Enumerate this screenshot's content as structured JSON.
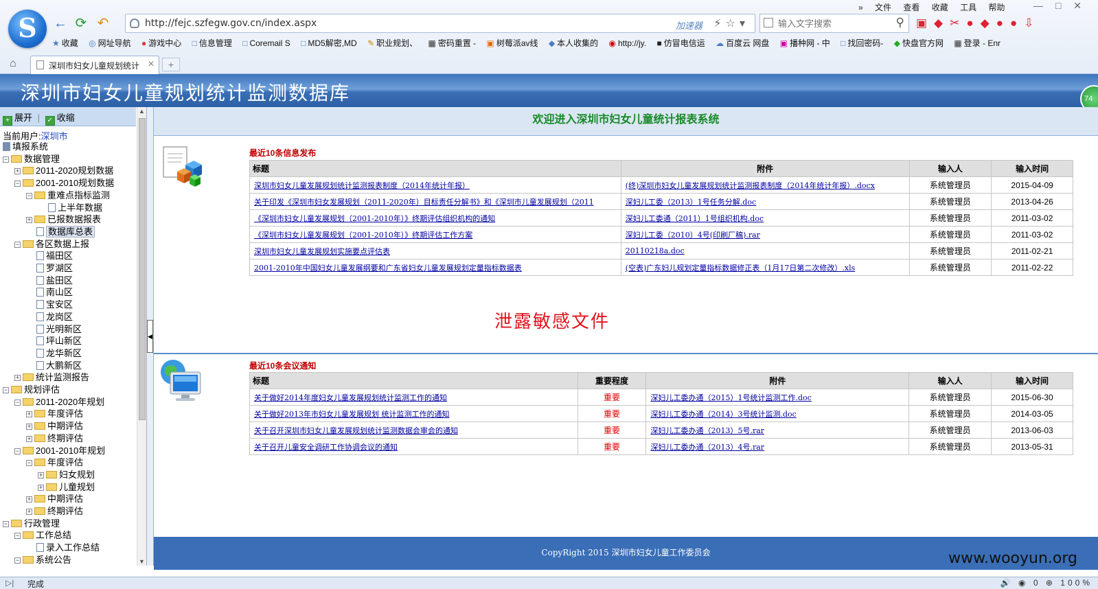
{
  "browser": {
    "menu": [
      "文件",
      "查看",
      "收藏",
      "工具",
      "帮助"
    ],
    "url": "http://fejc.szfegw.gov.cn/index.aspx",
    "accelerator": "加速器",
    "search_placeholder": "输入文字搜索",
    "bookmarks": [
      "收藏",
      "网址导航",
      "游戏中心",
      "信息管理",
      "Coremail S",
      "MD5解密,MD",
      "职业规划、",
      "密码重置 -",
      "树莓派av线",
      "本人收集的",
      "http://jy.",
      "仿冒电信运",
      "百度云 网盘",
      "播种网 - 中",
      "找回密码-",
      "快盘官方网",
      "登录 - Enr"
    ],
    "tab_title": "深圳市妇女儿童规划统计",
    "status_left": "完成",
    "status_right": "100%",
    "status_count": "0"
  },
  "page": {
    "banner_title": "深圳市妇女儿童规划统计监测数据库",
    "badge": "74",
    "sidebar": {
      "expand": "展开",
      "collapse": "收缩",
      "current_user_label": "当前用户:",
      "current_user": "深圳市",
      "tree": [
        "填报系统",
        "数据管理",
        "2011-2020规划数据",
        "2001-2010规划数据",
        "重难点指标监测",
        "上半年数据",
        "已报数据报表",
        "数据库总表",
        "各区数据上报",
        "福田区",
        "罗湖区",
        "盐田区",
        "南山区",
        "宝安区",
        "龙岗区",
        "光明新区",
        "坪山新区",
        "龙华新区",
        "大鹏新区",
        "统计监测报告",
        "规划评估",
        "2011-2020年规划",
        "年度评估",
        "中期评估",
        "终期评估",
        "2001-2010年规划",
        "年度评估",
        "妇女规划",
        "儿童规划",
        "中期评估",
        "终期评估",
        "行政管理",
        "工作总结",
        "录入工作总结",
        "系统公告"
      ]
    },
    "welcome": "欢迎进入深圳市妇女儿童统计报表系统",
    "info": {
      "title": "最近10条信息发布",
      "headers": [
        "标题",
        "附件",
        "输入人",
        "输入时间"
      ],
      "rows": [
        [
          "深圳市妇女儿童发展规划统计监测报表制度（2014年统计年报）",
          "(终)深圳市妇女儿童发展规划统计监测报表制度（2014年统计年报）.docx",
          "系统管理员",
          "2015-04-09"
        ],
        [
          "关于印发《深圳市妇女发展规划（2011-2020年）目标责任分解书》和《深圳市儿童发展规划（2011",
          "深妇儿工委（2013）1号任务分解.doc",
          "系统管理员",
          "2013-04-26"
        ],
        [
          "《深圳市妇女儿童发展规划（2001-2010年）》终期评估组织机构的通知",
          "深妇儿工委通（2011）1号组织机构.doc",
          "系统管理员",
          "2011-03-02"
        ],
        [
          "《深圳市妇女儿童发展规划（2001-2010年）》终期评估工作方案",
          "深妇儿工委（2010）4号(印刷厂稿).rar",
          "系统管理员",
          "2011-03-02"
        ],
        [
          "深圳市妇女儿童发展规划实施要点评估表",
          "20110218a.doc",
          "系统管理员",
          "2011-02-21"
        ],
        [
          "2001-2010年中国妇女儿童发展纲要和广东省妇女儿童发展规划定量指标数据表",
          "(空表)广东妇儿规划定量指标数据修正表（1月17日第二次修改）.xls",
          "系统管理员",
          "2011-02-22"
        ]
      ]
    },
    "leak_text": "泄露敏感文件",
    "meeting": {
      "title": "最近10条会议通知",
      "headers": [
        "标题",
        "重要程度",
        "附件",
        "输入人",
        "输入时间"
      ],
      "rows": [
        [
          "关于做好2014年度妇女儿童发展规划统计监测工作的通知",
          "重要",
          "深妇儿工委办通（2015）1号统计监测工作.doc",
          "系统管理员",
          "2015-06-30"
        ],
        [
          "关于做好2013年市妇女儿童发展规划 统计监测工作的通知",
          "重要",
          "深妇儿工委办通（2014）3号统计监测.doc",
          "系统管理员",
          "2014-03-05"
        ],
        [
          "关于召开深圳市妇女儿童发展规划统计监测数据会审会的通知",
          "重要",
          "深妇儿工委办通（2013）5号.rar",
          "系统管理员",
          "2013-06-03"
        ],
        [
          "关于召开儿童安全调研工作协调会议的通知",
          "重要",
          "深妇儿工委办通（2013）4号.rar",
          "系统管理员",
          "2013-05-31"
        ]
      ]
    },
    "footer": "CopyRight 2015 深圳市妇女儿童工作委员会",
    "watermark": "www.wooyun.org"
  }
}
